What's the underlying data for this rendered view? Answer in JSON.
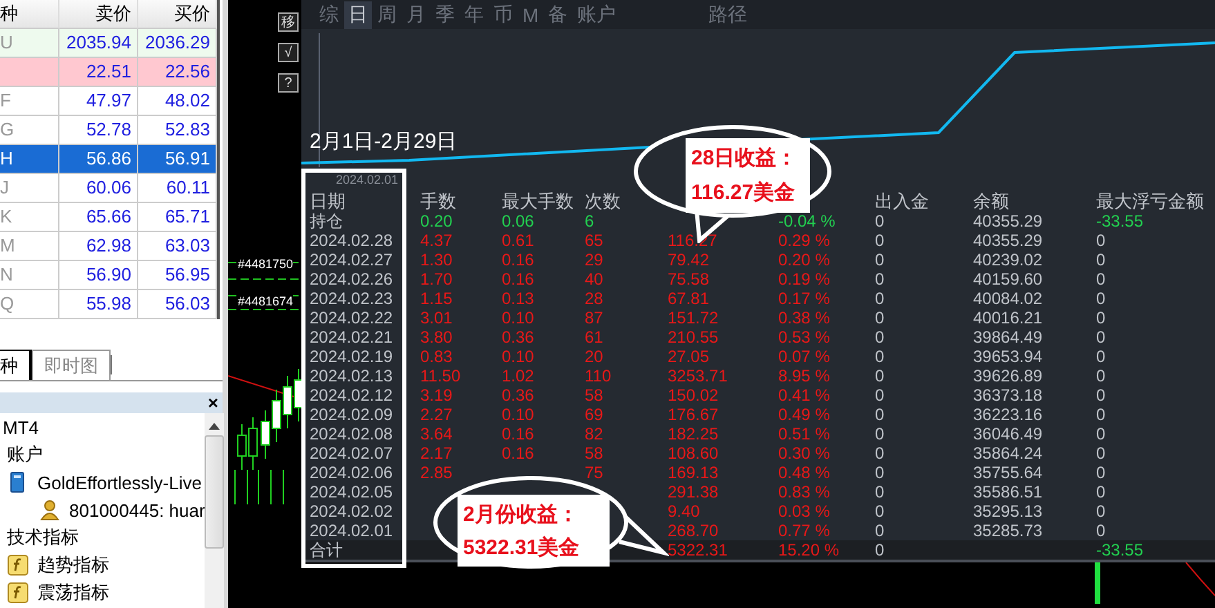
{
  "market_watch": {
    "columns": [
      "种",
      "卖价",
      "买价"
    ],
    "rows": [
      {
        "symbol": "U",
        "bid": "2035.94",
        "ask": "2036.29",
        "selected": false,
        "color": "#eefaee"
      },
      {
        "bid": "22.51",
        "ask": "22.56",
        "selected": false,
        "color": "#ffc8d0"
      },
      {
        "symbol": "F",
        "bid": "47.97",
        "ask": "48.02",
        "selected": false,
        "color": "#ffffff"
      },
      {
        "symbol": "G",
        "bid": "52.78",
        "ask": "52.83",
        "selected": false,
        "color": "#ffffff"
      },
      {
        "symbol": "H",
        "bid": "56.86",
        "ask": "56.91",
        "selected": true
      },
      {
        "symbol": "J",
        "bid": "60.06",
        "ask": "60.11",
        "selected": false,
        "color": "#ffffff"
      },
      {
        "symbol": "K",
        "bid": "65.66",
        "ask": "65.71",
        "selected": false,
        "color": "#ffffff"
      },
      {
        "symbol": "M",
        "bid": "62.98",
        "ask": "63.03",
        "selected": false,
        "color": "#ffffff"
      },
      {
        "symbol": "N",
        "bid": "56.90",
        "ask": "56.95",
        "selected": false,
        "color": "#ffffff"
      },
      {
        "symbol": "Q",
        "bid": "55.98",
        "ask": "56.03",
        "selected": false,
        "color": "#ffffff"
      }
    ]
  },
  "tabs": [
    {
      "label": "种",
      "selected": true
    },
    {
      "label": "即时图",
      "selected": false
    }
  ],
  "navigator": {
    "close": "×",
    "tree": [
      {
        "label": "MT4",
        "children": [
          {
            "label": "账户",
            "children": [
              {
                "label": "GoldEffortlessly-Live",
                "kind": "server",
                "children": [
                  {
                    "label": "801000445: huar",
                    "kind": "user"
                  }
                ]
              }
            ]
          },
          {
            "label": "技术指标",
            "children": [
              {
                "label": "趋势指标",
                "kind": "indicator"
              },
              {
                "label": "震荡指标",
                "kind": "indicator"
              }
            ]
          }
        ]
      }
    ]
  },
  "chart": {
    "side_buttons": [
      "移",
      "√",
      "?"
    ],
    "order_labels": [
      "#4481750",
      "#4481674"
    ]
  },
  "report": {
    "tabs": [
      {
        "label": "综",
        "selected": false
      },
      {
        "label": "日",
        "selected": true
      },
      {
        "label": "周",
        "selected": false
      },
      {
        "label": "月",
        "selected": false
      },
      {
        "label": "季",
        "selected": false
      },
      {
        "label": "年",
        "selected": false
      },
      {
        "label": "币",
        "selected": false
      },
      {
        "label": "M",
        "selected": false
      },
      {
        "label": "备",
        "selected": false
      },
      {
        "label": "账户",
        "selected": false
      }
    ],
    "tools": [
      {
        "label": "路径",
        "selected": false
      }
    ],
    "period": "2月1日-2月29日",
    "date_hint": "2024.02.01",
    "columns": [
      "日期",
      "手数",
      "最大手数",
      "次数",
      null,
      null,
      "出入金",
      "余额",
      "最大浮亏金额"
    ],
    "rows": [
      {
        "kind": "position",
        "cells": [
          "持仓",
          "0.20",
          "0.06",
          "6",
          null,
          "-0.04 %",
          "0",
          "40355.29",
          "-33.55"
        ]
      },
      {
        "kind": "day",
        "cells": [
          "2024.02.28",
          "4.37",
          "0.61",
          "65",
          "116.27",
          "0.29 %",
          "0",
          "40355.29",
          "0"
        ]
      },
      {
        "kind": "day",
        "cells": [
          "2024.02.27",
          "1.30",
          "0.16",
          "29",
          "79.42",
          "0.20 %",
          "0",
          "40239.02",
          "0"
        ]
      },
      {
        "kind": "day",
        "cells": [
          "2024.02.26",
          "1.70",
          "0.16",
          "40",
          "75.58",
          "0.19 %",
          "0",
          "40159.60",
          "0"
        ]
      },
      {
        "kind": "day",
        "cells": [
          "2024.02.23",
          "1.15",
          "0.13",
          "28",
          "67.81",
          "0.17 %",
          "0",
          "40084.02",
          "0"
        ]
      },
      {
        "kind": "day",
        "cells": [
          "2024.02.22",
          "3.01",
          "0.10",
          "87",
          "151.72",
          "0.38 %",
          "0",
          "40016.21",
          "0"
        ]
      },
      {
        "kind": "day",
        "cells": [
          "2024.02.21",
          "3.80",
          "0.36",
          "61",
          "210.55",
          "0.53 %",
          "0",
          "39864.49",
          "0"
        ]
      },
      {
        "kind": "day",
        "cells": [
          "2024.02.19",
          "0.83",
          "0.10",
          "20",
          "27.05",
          "0.07 %",
          "0",
          "39653.94",
          "0"
        ]
      },
      {
        "kind": "day",
        "cells": [
          "2024.02.13",
          "11.50",
          "1.02",
          "110",
          "3253.71",
          "8.95 %",
          "0",
          "39626.89",
          "0"
        ]
      },
      {
        "kind": "day",
        "cells": [
          "2024.02.12",
          "3.19",
          "0.36",
          "58",
          "150.02",
          "0.41 %",
          "0",
          "36373.18",
          "0"
        ]
      },
      {
        "kind": "day",
        "cells": [
          "2024.02.09",
          "2.27",
          "0.10",
          "69",
          "176.67",
          "0.49 %",
          "0",
          "36223.16",
          "0"
        ]
      },
      {
        "kind": "day",
        "cells": [
          "2024.02.08",
          "3.64",
          "0.16",
          "82",
          "182.25",
          "0.51 %",
          "0",
          "36046.49",
          "0"
        ]
      },
      {
        "kind": "day",
        "cells": [
          "2024.02.07",
          "2.17",
          "0.16",
          "58",
          "108.60",
          "0.30 %",
          "0",
          "35864.24",
          "0"
        ]
      },
      {
        "kind": "day",
        "cells": [
          "2024.02.06",
          "2.85",
          null,
          "75",
          "169.13",
          "0.48 %",
          "0",
          "35755.64",
          "0"
        ]
      },
      {
        "kind": "day",
        "cells": [
          "2024.02.05",
          null,
          null,
          null,
          "291.38",
          "0.83 %",
          "0",
          "35586.51",
          "0"
        ]
      },
      {
        "kind": "day",
        "cells": [
          "2024.02.02",
          null,
          null,
          null,
          "9.40",
          "0.03 %",
          "0",
          "35295.13",
          "0"
        ]
      },
      {
        "kind": "day",
        "cells": [
          "2024.02.01",
          null,
          null,
          null,
          "268.70",
          "0.77 %",
          "0",
          "35285.73",
          "0"
        ]
      },
      {
        "kind": "total",
        "cells": [
          "合计",
          null,
          null,
          null,
          "5322.31",
          "15.20 %",
          "0",
          null,
          "-33.55"
        ]
      }
    ]
  },
  "callouts": [
    {
      "lines": [
        "28日收益：",
        "116.27美金"
      ]
    },
    {
      "lines": [
        "2月份收益：",
        "5322.31美金"
      ]
    }
  ]
}
